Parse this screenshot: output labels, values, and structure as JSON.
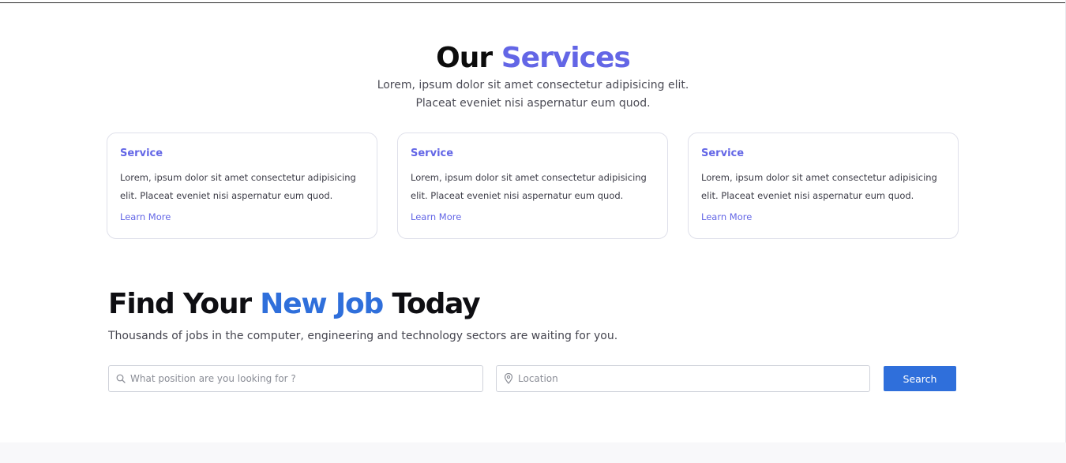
{
  "services": {
    "title_prefix": "Our",
    "title_accent": "Services",
    "subtitle_line1": "Lorem, ipsum dolor sit amet consectetur adipisicing elit.",
    "subtitle_line2": "Placeat eveniet nisi aspernatur eum quod.",
    "cards": [
      {
        "title": "Service",
        "text_line1": "Lorem, ipsum dolor sit amet consectetur adipisicing",
        "text_line2": "elit. Placeat eveniet nisi aspernatur eum quod.",
        "link": "Learn More"
      },
      {
        "title": "Service",
        "text_line1": "Lorem, ipsum dolor sit amet consectetur adipisicing",
        "text_line2": "elit. Placeat eveniet nisi aspernatur eum quod.",
        "link": "Learn More"
      },
      {
        "title": "Service",
        "text_line1": "Lorem, ipsum dolor sit amet consectetur adipisicing",
        "text_line2": "elit. Placeat eveniet nisi aspernatur eum quod.",
        "link": "Learn More"
      }
    ]
  },
  "jobs": {
    "title_prefix": "Find Your ",
    "title_accent": "New Job",
    "title_suffix": " Today",
    "subtitle": "Thousands of jobs in the computer, engineering and technology sectors are waiting for you.",
    "position_placeholder": "What position are you looking for ?",
    "position_icon": "search-icon",
    "location_placeholder": "Location",
    "location_icon": "map-pin-icon",
    "search_label": "Search"
  },
  "colors": {
    "services_accent": "#6366e6",
    "jobs_accent": "#2f6fdb",
    "button_bg": "#2f6fdb"
  }
}
